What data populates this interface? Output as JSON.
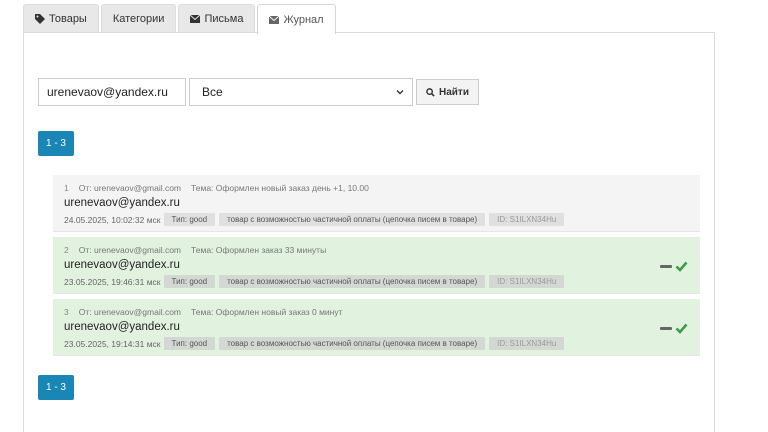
{
  "tabs": [
    {
      "label": "Товары",
      "icon": "tag-icon",
      "active": false
    },
    {
      "label": "Категории",
      "icon": "",
      "active": false
    },
    {
      "label": "Письма",
      "icon": "envelope-icon",
      "active": false
    },
    {
      "label": "Журнал",
      "icon": "envelope-icon",
      "active": true
    }
  ],
  "search": {
    "email_value": "urenevaov@yandex.ru",
    "filter_selected": "Все",
    "find_label": "Найти"
  },
  "pagination": {
    "label": "1 - 3"
  },
  "colors": {
    "accent": "#1a86b5",
    "row_sent": "#e1f2df",
    "row_pending": "#f4f4f4",
    "check": "#3c9b47"
  },
  "log": [
    {
      "num": "1",
      "from": "От: urenevaov@gmail.com",
      "subject": "Тема: Оформлен новый заказ день +1, 10.00",
      "email": "urenevaov@yandex.ru",
      "date": "24.05.2025, 10:02:32 мск",
      "type": "Тип: good",
      "product": "товар с возможностью частичной оплаты (цепочка писем в товаре)",
      "id": "ID: S1ILXN34Hu",
      "sent": false
    },
    {
      "num": "2",
      "from": "От: urenevaov@gmail.com",
      "subject": "Тема: Оформлен заказ 33 минуты",
      "email": "urenevaov@yandex.ru",
      "date": "23.05.2025, 19:46:31 мск",
      "type": "Тип: good",
      "product": "товар с возможностью частичной оплаты (цепочка писем в товаре)",
      "id": "ID: S1ILXN34Hu",
      "sent": true
    },
    {
      "num": "3",
      "from": "От: urenevaov@gmail.com",
      "subject": "Тема: Оформлен новый заказ 0 минут",
      "email": "urenevaov@yandex.ru",
      "date": "23.05.2025, 19:14:31 мск",
      "type": "Тип: good",
      "product": "товар с возможностью частичной оплаты (цепочка писем в товаре)",
      "id": "ID: S1ILXN34Hu",
      "sent": true
    }
  ]
}
